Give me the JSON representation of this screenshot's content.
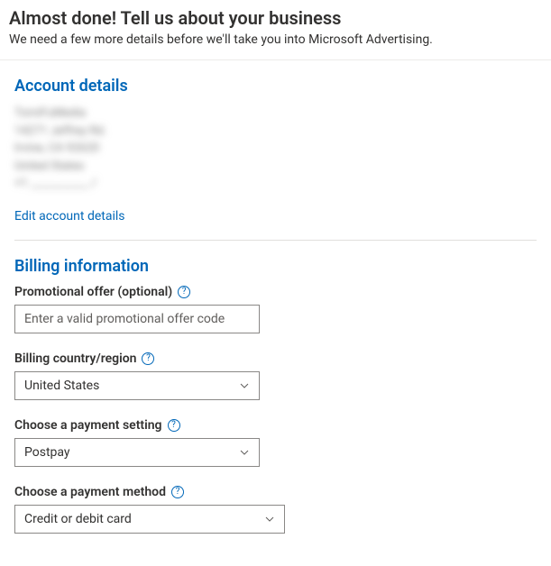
{
  "header": {
    "title": "Almost done! Tell us about your business",
    "subtitle": "We need a few more details before we'll take you into Microsoft Advertising."
  },
  "account": {
    "section_title": "Account details",
    "line1": "TomiFuMedia",
    "line2": "14271 Jeffrey Rd.",
    "line3": "Irvine, CA 92620",
    "line4": "United States",
    "line5": "+1 ___________ /",
    "edit_link": "Edit account details"
  },
  "billing": {
    "section_title": "Billing information",
    "promo": {
      "label": "Promotional offer (optional)",
      "placeholder": "Enter a valid promotional offer code",
      "value": ""
    },
    "country": {
      "label": "Billing country/region",
      "selected": "United States"
    },
    "setting": {
      "label": "Choose a payment setting",
      "selected": "Postpay"
    },
    "method": {
      "label": "Choose a payment method",
      "selected": "Credit or debit card"
    }
  }
}
